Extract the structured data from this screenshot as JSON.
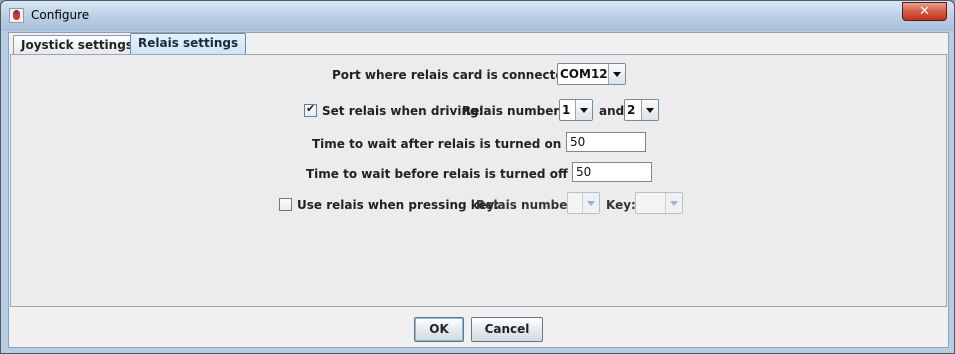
{
  "window": {
    "title": "Configure",
    "close_label": "✕"
  },
  "tabs": [
    {
      "label": "Joystick settings"
    },
    {
      "label": "Relais settings"
    }
  ],
  "relais": {
    "port_label": "Port where relais card is connected to:",
    "port_value": "COM12",
    "set_when_driving_label": "Set relais when driving:",
    "set_when_driving_checked": true,
    "check_mark": "✔",
    "relais_numbers_label": "Relais numbers:",
    "relais_num_1": "1",
    "and_label": "and",
    "relais_num_2": "2",
    "wait_on_label": "Time to wait after relais is turned on [in ms]:",
    "wait_on_value": "50",
    "wait_off_label": "Time to wait before relais is turned off [in ms]:",
    "wait_off_value": "50",
    "use_key_label": "Use relais when pressing key:",
    "use_key_checked": false,
    "relais_number_label": "Relais number:",
    "relais_number_value": "",
    "key_label": "Key:",
    "key_value": ""
  },
  "buttons": {
    "ok": "OK",
    "cancel": "Cancel"
  }
}
